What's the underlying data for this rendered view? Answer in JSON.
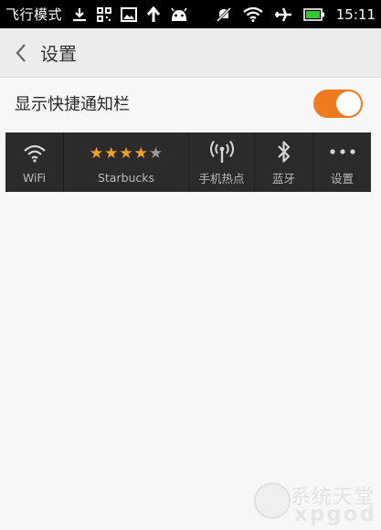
{
  "status_bar": {
    "airplane_mode_label": "飞行模式",
    "time": "15:11",
    "icons": [
      "download-icon",
      "qr-icon",
      "image-icon",
      "upload-arrow-icon",
      "android-icon",
      "mute-icon",
      "wifi-icon",
      "airplane-icon",
      "battery-icon"
    ],
    "battery_color": "#32c832"
  },
  "header": {
    "title": "设置"
  },
  "setting": {
    "label": "显示快捷通知栏",
    "toggle_on": true,
    "toggle_color": "#f07a1e"
  },
  "quick_bar": {
    "items": [
      {
        "label": "WiFi",
        "icon": "wifi-icon"
      },
      {
        "label": "Starbucks",
        "icon": "rating-stars",
        "rating": 4,
        "max_rating": 5
      },
      {
        "label": "手机热点",
        "icon": "hotspot-icon"
      },
      {
        "label": "蓝牙",
        "icon": "bluetooth-icon"
      },
      {
        "label": "设置",
        "icon": "more-dots-icon"
      }
    ],
    "star_color": "#f3a21d"
  },
  "watermark": {
    "line1": "系统天堂",
    "line2": "xpgod"
  }
}
